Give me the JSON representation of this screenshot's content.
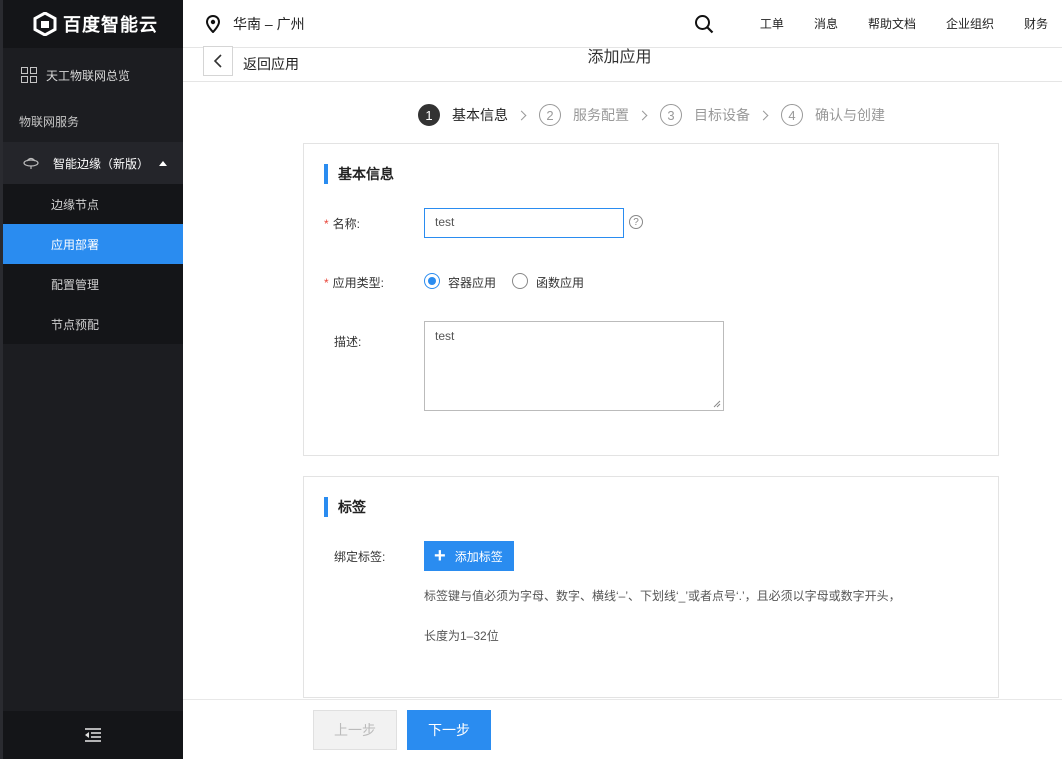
{
  "brand": {
    "name": "百度智能云"
  },
  "header": {
    "region": "华南 – 广州",
    "links": [
      "工单",
      "消息",
      "帮助文档",
      "企业组织",
      "财务"
    ]
  },
  "sidebar": {
    "overview": "天工物联网总览",
    "section": "物联网服务",
    "group": "智能边缘（新版）",
    "items": [
      {
        "label": "边缘节点",
        "active": false
      },
      {
        "label": "应用部署",
        "active": true
      },
      {
        "label": "配置管理",
        "active": false
      },
      {
        "label": "节点预配",
        "active": false
      }
    ]
  },
  "page": {
    "back_label": "返回应用",
    "title": "添加应用"
  },
  "steps": [
    {
      "num": "1",
      "label": "基本信息",
      "active": true
    },
    {
      "num": "2",
      "label": "服务配置",
      "active": false
    },
    {
      "num": "3",
      "label": "目标设备",
      "active": false
    },
    {
      "num": "4",
      "label": "确认与创建",
      "active": false
    }
  ],
  "basic_info": {
    "title": "基本信息",
    "name_label": "名称:",
    "name_value": "test",
    "type_label": "应用类型:",
    "type_options": [
      "容器应用",
      "函数应用"
    ],
    "type_selected": "容器应用",
    "desc_label": "描述:",
    "desc_value": "test"
  },
  "tags": {
    "title": "标签",
    "bind_label": "绑定标签:",
    "add_button": "添加标签",
    "hint_line1": "标签键与值必须为字母、数字、横线‘–’、下划线‘_’或者点号‘.’，且必须以字母或数字开头，",
    "hint_line2": "长度为1–32位"
  },
  "footer": {
    "prev": "上一步",
    "next": "下一步"
  },
  "colors": {
    "accent": "#2a8cf0",
    "sidebar_bg": "#1c1d21",
    "required": "#e8463a"
  }
}
